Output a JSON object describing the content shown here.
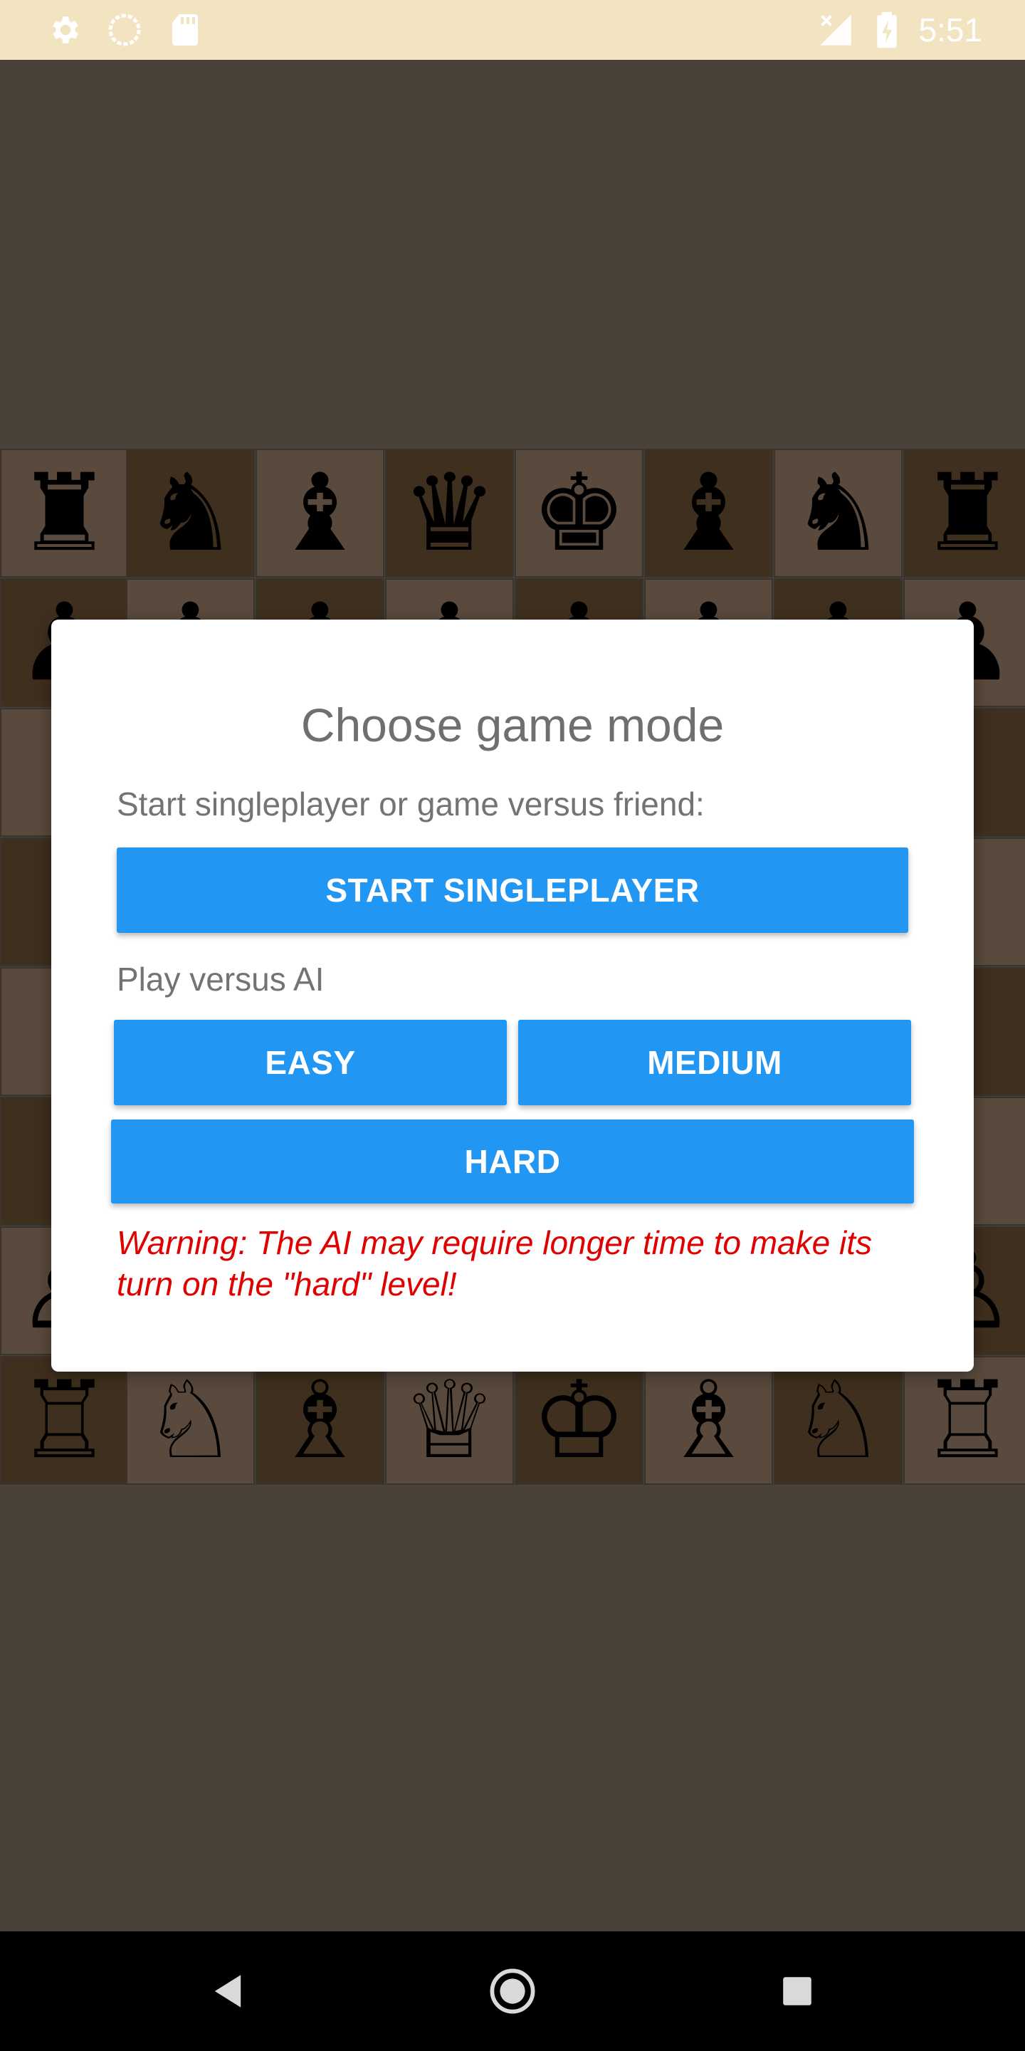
{
  "status_bar": {
    "time": "5:51",
    "left_icons": [
      "gear-icon",
      "circle-icon",
      "sd-card-icon"
    ],
    "right_icons": [
      "no-signal-icon",
      "battery-charging-icon"
    ],
    "background": "#f2e4c0"
  },
  "board": {
    "top_row": [
      "♜",
      "♞",
      "♝",
      "♛",
      "♚",
      "♝",
      "♞",
      "♜"
    ],
    "bottom_row": [
      "♖",
      "♘",
      "♗",
      "♕",
      "♔",
      "♗",
      "♘",
      "♖"
    ],
    "pawn_black": "♟",
    "pawn_white": "♙"
  },
  "dialog": {
    "title": "Choose game mode",
    "subtitle": "Start singleplayer or game versus friend:",
    "start_singleplayer": "START SINGLEPLAYER",
    "ai_label": "Play versus AI",
    "easy": "EASY",
    "medium": "MEDIUM",
    "hard": "HARD",
    "warning": "Warning: The AI may require longer time to make its turn on the \"hard\" level!"
  },
  "colors": {
    "accent": "#2196f3",
    "warning": "#e00000"
  },
  "nav_bar": {
    "icons": [
      "back-icon",
      "home-icon",
      "recents-icon"
    ]
  }
}
